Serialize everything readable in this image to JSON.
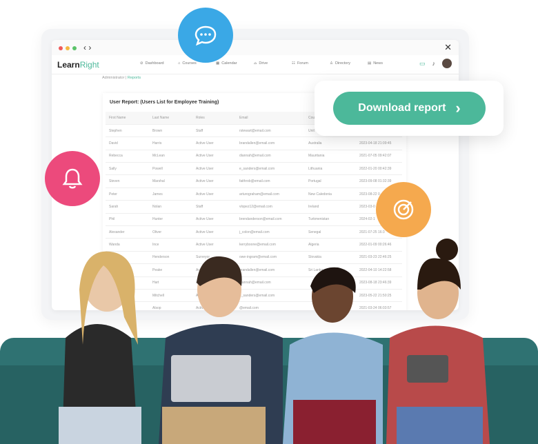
{
  "app": {
    "logo_a": "Learn",
    "logo_b": "Right"
  },
  "nav": [
    {
      "icon": "⊘",
      "label": "Dashboard"
    },
    {
      "icon": "⌂",
      "label": "Courses"
    },
    {
      "icon": "▦",
      "label": "Calendar"
    },
    {
      "icon": "⌓",
      "label": "Drive"
    },
    {
      "icon": "☷",
      "label": "Forum"
    },
    {
      "icon": "♙",
      "label": "Directory"
    },
    {
      "icon": "▤",
      "label": "News"
    }
  ],
  "breadcrumb": {
    "root": "Administrator",
    "sep": " | ",
    "current": "Reports"
  },
  "report": {
    "title": "User Report: (Users List for Employee Training)",
    "columns": [
      "First Name",
      "Last Name",
      "Roles",
      "Email",
      "Cou",
      ""
    ],
    "rows": [
      [
        "Stephen",
        "Brown",
        "Staff",
        "rstewart@email.com",
        "Unit",
        ""
      ],
      [
        "David",
        "Harris",
        "Active User",
        "brandallen@email.com",
        "Australia",
        "2023-04-18 21:09:45"
      ],
      [
        "Rebecca",
        "McLean",
        "Active User",
        "diannah@email.com",
        "Mauritania",
        "2021-07-05 09:42:07"
      ],
      [
        "Sally",
        "Powell",
        "Active User",
        "e_sanders@email.com",
        "Lithuania",
        "2022-01-20 00:42:39"
      ],
      [
        "Steven",
        "Marshal",
        "Active User",
        "faithrob@email.com",
        "Portugal",
        "2023-09-08 01:32:39"
      ],
      [
        "Peter",
        "James",
        "Active User",
        "arturograham@email.com",
        "New Caledonia",
        "2023-08-22 0"
      ],
      [
        "Sarah",
        "Nolan",
        "Staff",
        "vlopez12@email.com",
        "Ireland",
        "2023-03-0"
      ],
      [
        "Phil",
        "Hunter",
        "Active User",
        "brendanderson@email.com",
        "Turkmenistan",
        "2024-02-1"
      ],
      [
        "Alexander",
        "Oliver",
        "Active User",
        "j_colon@email.com",
        "Senegal",
        "2021-07-25 16:3"
      ],
      [
        "Wanda",
        "Ince",
        "Active User",
        "kerryboone@email.com",
        "Algeria",
        "2022-01-09 00:26:46"
      ],
      [
        "",
        "Henderson",
        "Surveyor",
        "owe-ingram@email.com",
        "Slovakia",
        "2021-03-23 22:46:25"
      ],
      [
        "",
        "Peake",
        "Active User",
        "brandallen@email.com",
        "Sri Lanka",
        "2022-04-10 14:22:58"
      ],
      [
        "",
        "Hart",
        "Active User",
        "diannah@email.com",
        "",
        "2023-08-18 23:46:39"
      ],
      [
        "",
        "Mitchell",
        "Active User",
        "e_sanders@email.com",
        "",
        "2023-05-22 21:50:25"
      ],
      [
        "",
        "Alsop",
        "Active User",
        "@email.com",
        "",
        "2021-03-24 06:03:57"
      ]
    ]
  },
  "download": {
    "label": "Download report",
    "chevron": "›"
  },
  "colors": {
    "accent": "#4cb89a",
    "chat": "#3aa8e6",
    "bell": "#ec4a7c",
    "target": "#f5a94e"
  }
}
